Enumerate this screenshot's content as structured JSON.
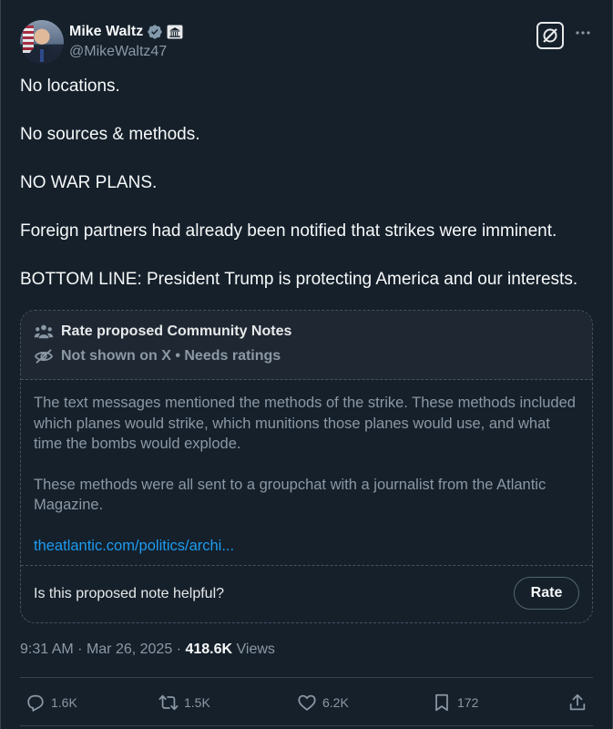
{
  "author": {
    "display_name": "Mike Waltz",
    "handle": "@MikeWaltz47"
  },
  "tweet": {
    "paragraphs": [
      "No locations.",
      "No sources & methods.",
      "NO WAR PLANS.",
      "Foreign partners had already been notified that strikes were imminent.",
      "BOTTOM LINE:  President Trump is protecting America and our interests."
    ]
  },
  "community_note": {
    "title": "Rate proposed Community Notes",
    "status": "Not shown on X • Needs ratings",
    "body": [
      "The text messages mentioned the methods of the strike. These methods included which planes would strike, which munitions those planes would use, and what time the bombs would explode.",
      "These methods were all sent to a groupchat with a journalist from the Atlantic Magazine."
    ],
    "link": "theatlantic.com/politics/archi...",
    "question": "Is this proposed note helpful?",
    "rate_label": "Rate"
  },
  "meta": {
    "time": "9:31 AM",
    "date": "Mar 26, 2025",
    "views_count": "418.6K",
    "views_label": "Views",
    "separator": "·"
  },
  "actions": {
    "replies": "1.6K",
    "reposts": "1.5K",
    "likes": "6.2K",
    "bookmarks": "172"
  },
  "icons": {
    "verified": "verified-badge-icon",
    "government": "government-affiliation-icon",
    "grok": "grok-icon",
    "more": "more-icon",
    "community": "community-notes-icon",
    "hidden": "eye-off-icon",
    "reply": "reply-icon",
    "repost": "repost-icon",
    "like": "heart-icon",
    "bookmark": "bookmark-icon",
    "share": "share-icon"
  },
  "colors": {
    "background": "#15202b",
    "link": "#1d9bf0",
    "verified": "#829aab",
    "muted": "#8b98a5"
  }
}
